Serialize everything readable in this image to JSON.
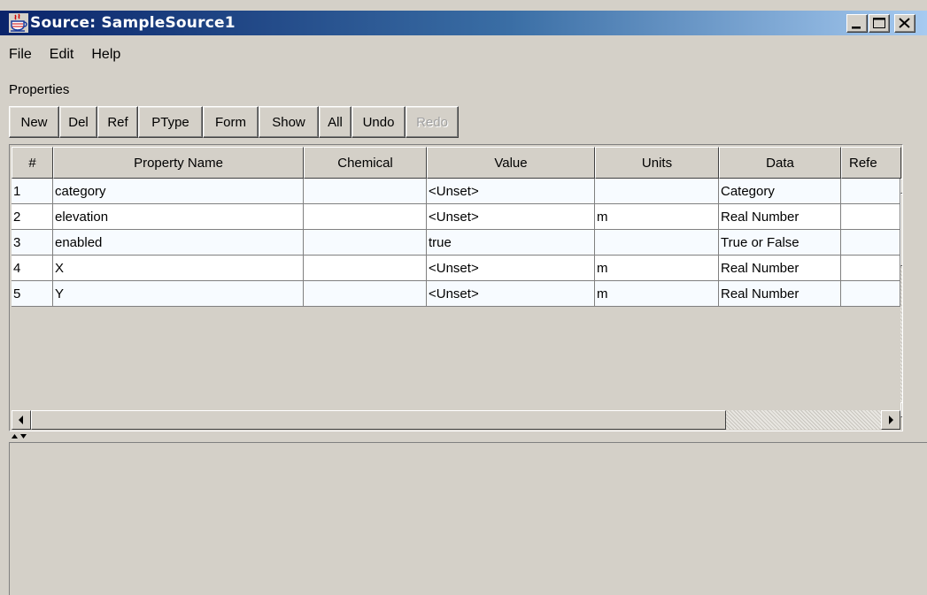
{
  "window": {
    "title": "Source: SampleSource1"
  },
  "menu": [
    "File",
    "Edit",
    "Help"
  ],
  "properties_label": "Properties",
  "toolbar": [
    {
      "label": "New",
      "enabled": true
    },
    {
      "label": "Del",
      "enabled": true
    },
    {
      "label": "Ref",
      "enabled": true
    },
    {
      "label": "PType",
      "enabled": true
    },
    {
      "label": "Form",
      "enabled": true
    },
    {
      "label": "Show",
      "enabled": true
    },
    {
      "label": "All",
      "enabled": true
    },
    {
      "label": "Undo",
      "enabled": true
    },
    {
      "label": "Redo",
      "enabled": false
    }
  ],
  "table": {
    "columns": [
      "#",
      "Property Name",
      "Chemical",
      "Value",
      "Units",
      "Data",
      "Refe"
    ],
    "rows": [
      [
        "1",
        "category",
        "",
        "<Unset>",
        "",
        "Category",
        ""
      ],
      [
        "2",
        "elevation",
        "",
        "<Unset>",
        "m",
        "Real Number",
        ""
      ],
      [
        "3",
        "enabled",
        "",
        "true",
        "",
        "True or False",
        ""
      ],
      [
        "4",
        "X",
        "",
        "<Unset>",
        "m",
        "Real Number",
        ""
      ],
      [
        "5",
        "Y",
        "",
        "<Unset>",
        "m",
        "Real Number",
        ""
      ]
    ]
  },
  "icons": {
    "app": "java-coffee-cup-icon",
    "minimize": "minimize-icon",
    "maximize": "maximize-icon",
    "close": "close-icon"
  },
  "colors": {
    "titlebar_start": "#0a246a",
    "titlebar_end": "#a6caf0",
    "window_bg": "#d4d0c8",
    "row_bg": "#f7fbff"
  }
}
